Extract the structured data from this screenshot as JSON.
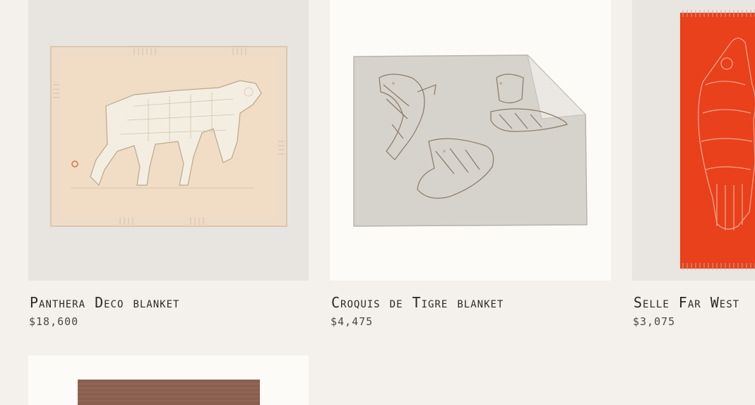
{
  "products": [
    {
      "name": "Panthera Deco blanket",
      "price": "$18,600"
    },
    {
      "name": "Croquis de Tigre blanket",
      "price": "$4,475"
    },
    {
      "name": "Selle Far West",
      "price": "$3,075"
    },
    {
      "name": "",
      "price": ""
    }
  ],
  "colors": {
    "page_background": "#f4f1ec",
    "name_text": "#2b2926",
    "price_text": "#4d4943",
    "selle_red": "#e8411c"
  }
}
